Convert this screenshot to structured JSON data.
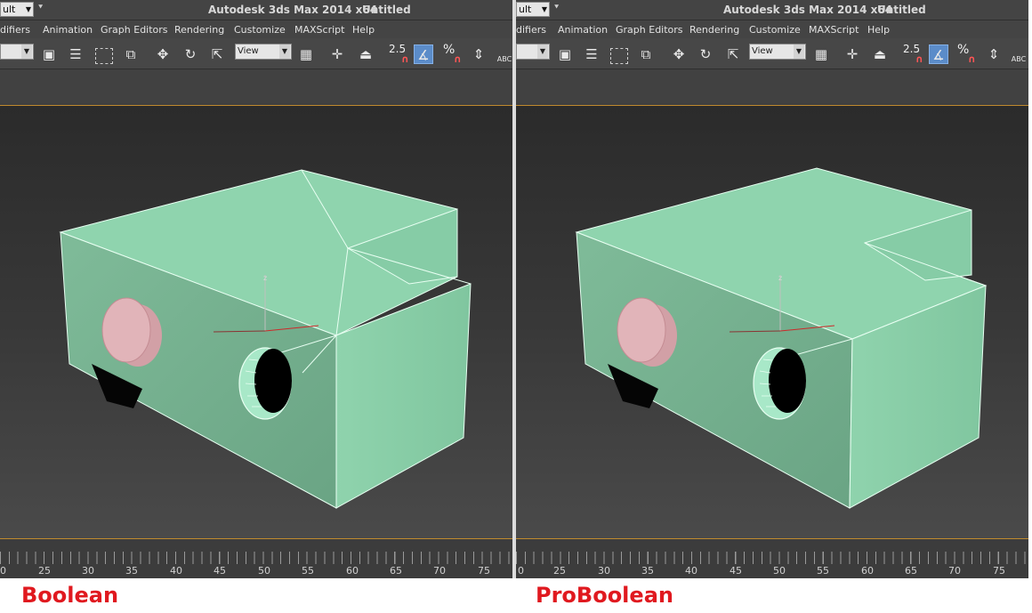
{
  "app": {
    "workspace_partial": "ult",
    "title": "Autodesk 3ds Max  2014 x64",
    "document": "Untitled"
  },
  "menu": [
    "difiers",
    "Animation",
    "Graph Editors",
    "Rendering",
    "Customize",
    "MAXScript",
    "Help"
  ],
  "toolbar": {
    "view_dropdown": "View",
    "snap_value": "2.5",
    "percent_snap": "%",
    "abc_label": "ABC"
  },
  "timeline": {
    "labels": [
      "0",
      "25",
      "30",
      "35",
      "40",
      "45",
      "50",
      "55",
      "60",
      "65",
      "70",
      "75"
    ]
  },
  "axis": {
    "z_label": "z"
  },
  "captions": {
    "left": "Boolean",
    "right": "ProBoolean"
  },
  "colors": {
    "object": "#8ecfaa",
    "cylinder": "#d8a8ad",
    "caption": "#e0191f",
    "viewport_border": "#c08a2e",
    "active_tool": "#5b8cc9"
  }
}
